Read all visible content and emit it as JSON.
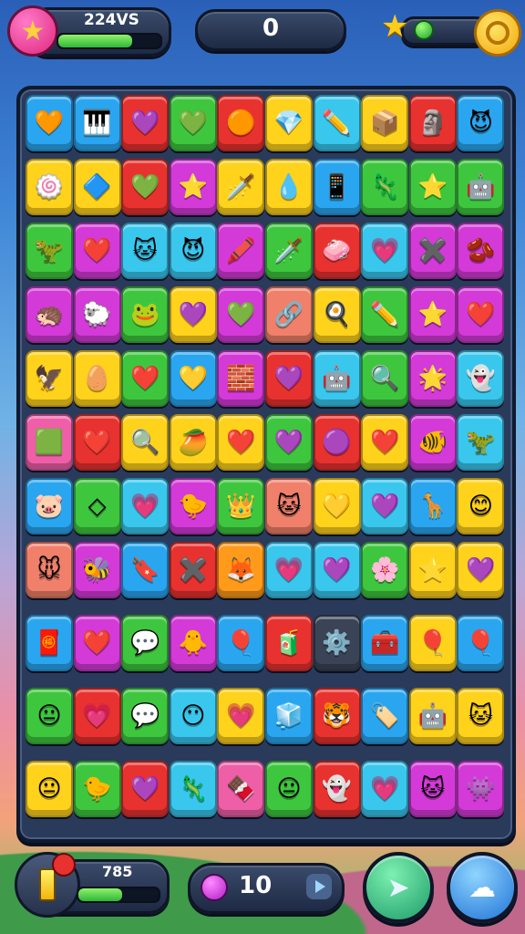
{
  "hud": {
    "score_label": "224VS",
    "score_progress": 0.72,
    "counter": "0",
    "star_icon": "star-icon",
    "coin_icon": "coin-icon",
    "avatar_icon": "star-avatar-icon"
  },
  "bottom": {
    "power_label": "785",
    "power_progress": 0.55,
    "moves_label": "10",
    "left_icon": "battery-icon",
    "moves_icon": "gem-icon",
    "play_icon": "play-icon",
    "shuffle_icon": "arrow-icon",
    "cloud_icon": "cloud-icon"
  },
  "colors": {
    "blue": "#2aa6f0",
    "red": "#e8322f",
    "magenta": "#d43ad8",
    "green": "#3ec73e",
    "yellow": "#ffd21c",
    "cyan": "#39c7ee",
    "pink": "#ee5fa8",
    "orange": "#ff9a1a",
    "salmon": "#f0806a",
    "lime": "#58d14a",
    "purple": "#9b4ae0",
    "grey": "#3a4456"
  },
  "board": {
    "rows": [
      [
        [
          "blue",
          "🧡"
        ],
        [
          "blue",
          "🎹"
        ],
        [
          "red",
          "💜"
        ],
        [
          "green",
          "💚"
        ],
        [
          "red",
          "🟠"
        ],
        [
          "yellow",
          "💎"
        ],
        [
          "cyan",
          "✏️"
        ],
        [
          "yellow",
          "📦"
        ],
        [
          "red",
          "🗿"
        ],
        [
          "blue",
          "😈"
        ]
      ],
      [
        [
          "yellow",
          "🍥"
        ],
        [
          "yellow",
          "🔷"
        ],
        [
          "red",
          "💚"
        ],
        [
          "magenta",
          "⭐"
        ],
        [
          "yellow",
          "🗡️"
        ],
        [
          "yellow",
          "💧"
        ],
        [
          "blue",
          "📱"
        ],
        [
          "green",
          "🦎"
        ],
        [
          "green",
          "⭐"
        ],
        [
          "green",
          "🤖"
        ]
      ],
      [
        [
          "green",
          "🦖"
        ],
        [
          "magenta",
          "❤️"
        ],
        [
          "cyan",
          "🐱"
        ],
        [
          "cyan",
          "😈"
        ],
        [
          "magenta",
          "🖍️"
        ],
        [
          "green",
          "🗡️"
        ],
        [
          "red",
          "🧼"
        ],
        [
          "cyan",
          "💗"
        ],
        [
          "magenta",
          "✖️"
        ],
        [
          "magenta",
          "🫘"
        ]
      ],
      [
        [
          "magenta",
          "🦔"
        ],
        [
          "magenta",
          "🐑"
        ],
        [
          "green",
          "🐸"
        ],
        [
          "yellow",
          "💜"
        ],
        [
          "magenta",
          "💚"
        ],
        [
          "salmon",
          "🔗"
        ],
        [
          "yellow",
          "🍳"
        ],
        [
          "green",
          "✏️"
        ],
        [
          "magenta",
          "⭐"
        ],
        [
          "magenta",
          "❤️"
        ]
      ],
      [
        [
          "yellow",
          "🦅"
        ],
        [
          "yellow",
          "🥚"
        ],
        [
          "green",
          "❤️"
        ],
        [
          "blue",
          "💛"
        ],
        [
          "magenta",
          "🧱"
        ],
        [
          "red",
          "💜"
        ],
        [
          "cyan",
          "🤖"
        ],
        [
          "green",
          "🔍"
        ],
        [
          "magenta",
          "🌟"
        ],
        [
          "cyan",
          "👻"
        ]
      ],
      [
        [
          "pink",
          "🟩"
        ],
        [
          "red",
          "❤️"
        ],
        [
          "yellow",
          "🔍"
        ],
        [
          "yellow",
          "🥭"
        ],
        [
          "yellow",
          "❤️"
        ],
        [
          "green",
          "💜"
        ],
        [
          "red",
          "🟣"
        ],
        [
          "yellow",
          "❤️"
        ],
        [
          "magenta",
          "🐠"
        ],
        [
          "cyan",
          "🦖"
        ]
      ],
      [
        [
          "blue",
          "🐷"
        ],
        [
          "green",
          "◇"
        ],
        [
          "cyan",
          "💗"
        ],
        [
          "magenta",
          "🐤"
        ],
        [
          "green",
          "👑"
        ],
        [
          "salmon",
          "🐱"
        ],
        [
          "yellow",
          "💛"
        ],
        [
          "cyan",
          "💜"
        ],
        [
          "blue",
          "🦒"
        ],
        [
          "yellow",
          "😊"
        ]
      ],
      [
        [
          "salmon",
          "🐭"
        ],
        [
          "magenta",
          "🐝"
        ],
        [
          "blue",
          "🔖"
        ],
        [
          "red",
          "✖️"
        ],
        [
          "orange",
          "🦊"
        ],
        [
          "cyan",
          "💗"
        ],
        [
          "cyan",
          "💜"
        ],
        [
          "green",
          "🌸"
        ],
        [
          "yellow",
          "⭐"
        ],
        [
          "yellow",
          "💜"
        ]
      ],
      [
        [
          "blue",
          "🧧"
        ],
        [
          "magenta",
          "❤️"
        ],
        [
          "green",
          "💬"
        ],
        [
          "magenta",
          "🐥"
        ],
        [
          "blue",
          "🎈"
        ],
        [
          "red",
          "🧃"
        ],
        [
          "grey",
          "⚙️"
        ],
        [
          "blue",
          "🧰"
        ],
        [
          "yellow",
          "🎈"
        ],
        [
          "blue",
          "🎈"
        ]
      ],
      [
        [
          "green",
          "😐"
        ],
        [
          "red",
          "💗"
        ],
        [
          "green",
          "💬"
        ],
        [
          "cyan",
          "😶"
        ],
        [
          "yellow",
          "💗"
        ],
        [
          "blue",
          "🧊"
        ],
        [
          "red",
          "🐯"
        ],
        [
          "blue",
          "🏷️"
        ],
        [
          "yellow",
          "🤖"
        ],
        [
          "yellow",
          "🐱"
        ]
      ],
      [
        [
          "yellow",
          "😐"
        ],
        [
          "green",
          "🐤"
        ],
        [
          "red",
          "💜"
        ],
        [
          "cyan",
          "🦎"
        ],
        [
          "pink",
          "🍫"
        ],
        [
          "green",
          "😐"
        ],
        [
          "red",
          "👻"
        ],
        [
          "cyan",
          "💗"
        ],
        [
          "magenta",
          "🐱"
        ],
        [
          "magenta",
          "👾"
        ]
      ]
    ]
  }
}
